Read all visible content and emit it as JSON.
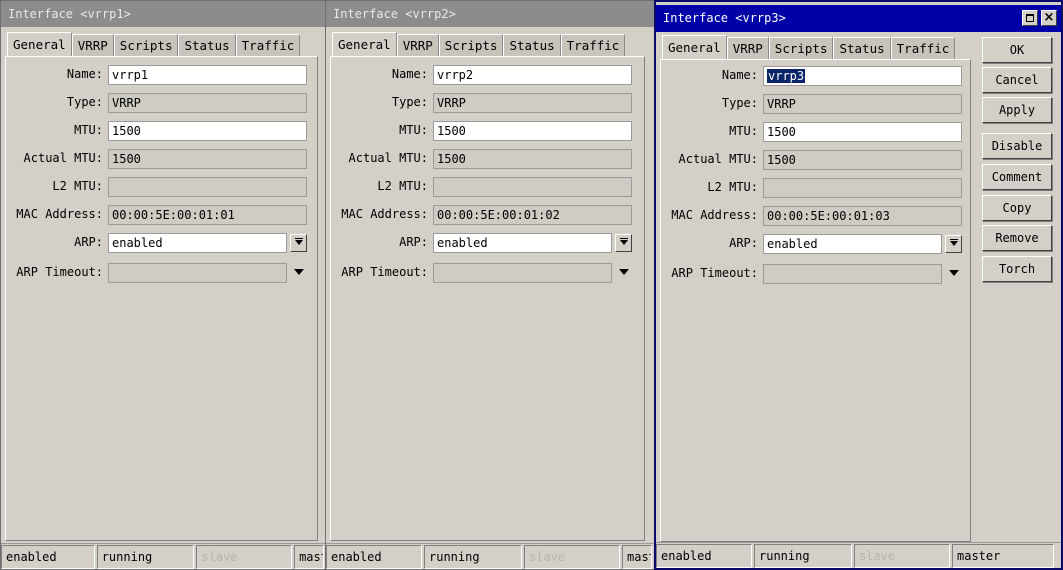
{
  "windows": [
    {
      "title": "Interface <vrrp1>",
      "tabs": [
        "General",
        "VRRP",
        "Scripts",
        "Status",
        "Traffic"
      ],
      "fields": {
        "name": "vrrp1",
        "type": "VRRP",
        "mtu": "1500",
        "actual_mtu": "1500",
        "l2_mtu": "",
        "mac_address": "00:00:5E:00:01:01",
        "arp": "enabled",
        "arp_timeout": ""
      },
      "status": [
        "enabled",
        "running",
        "slave",
        "master"
      ]
    },
    {
      "title": "Interface <vrrp2>",
      "tabs": [
        "General",
        "VRRP",
        "Scripts",
        "Status",
        "Traffic"
      ],
      "fields": {
        "name": "vrrp2",
        "type": "VRRP",
        "mtu": "1500",
        "actual_mtu": "1500",
        "l2_mtu": "",
        "mac_address": "00:00:5E:00:01:02",
        "arp": "enabled",
        "arp_timeout": ""
      },
      "status": [
        "enabled",
        "running",
        "slave",
        "master"
      ]
    },
    {
      "title": "Interface <vrrp3>",
      "tabs": [
        "General",
        "VRRP",
        "Scripts",
        "Status",
        "Traffic"
      ],
      "fields": {
        "name": "vrrp3",
        "type": "VRRP",
        "mtu": "1500",
        "actual_mtu": "1500",
        "l2_mtu": "",
        "mac_address": "00:00:5E:00:01:03",
        "arp": "enabled",
        "arp_timeout": ""
      },
      "status": [
        "enabled",
        "running",
        "slave",
        "master"
      ]
    }
  ],
  "labels": {
    "name": "Name:",
    "type": "Type:",
    "mtu": "MTU:",
    "actual_mtu": "Actual MTU:",
    "l2_mtu": "L2 MTU:",
    "mac_address": "MAC Address:",
    "arp": "ARP:",
    "arp_timeout": "ARP Timeout:"
  },
  "buttons": [
    "OK",
    "Cancel",
    "Apply",
    "Disable",
    "Comment",
    "Copy",
    "Remove",
    "Torch"
  ],
  "icons": {
    "title_restore": "restore-icon",
    "title_close": "close-icon"
  },
  "colors": {
    "active_titlebar": "#0000a8",
    "inactive_titlebar": "#8c8c8c",
    "selection": "#0a246a"
  }
}
